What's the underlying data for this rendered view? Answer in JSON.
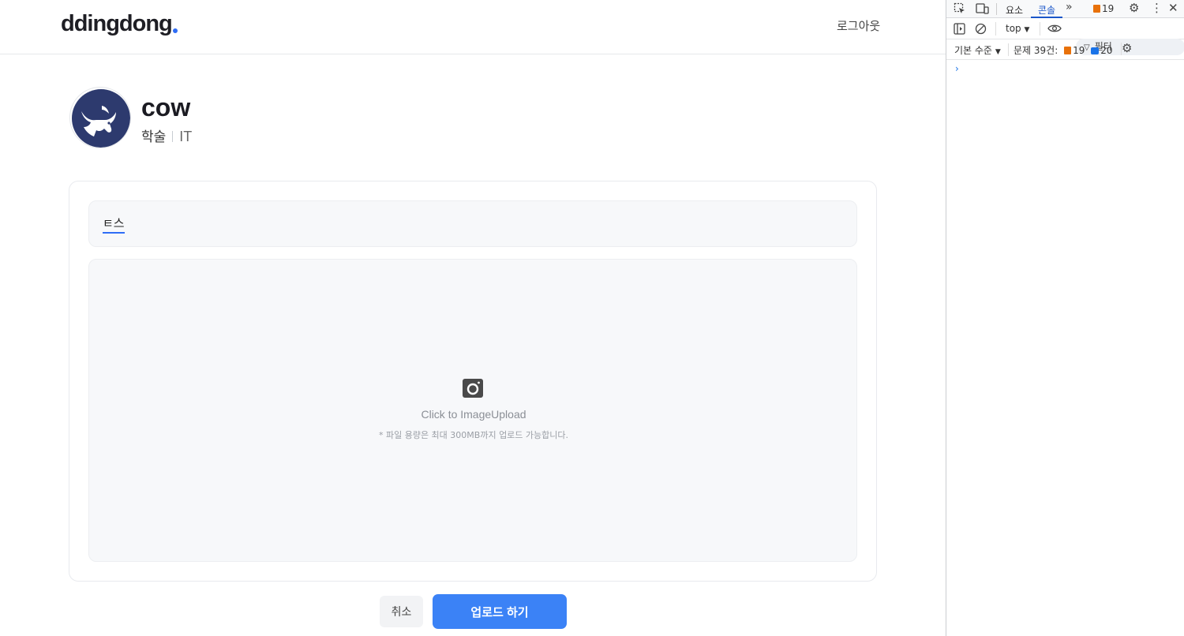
{
  "header": {
    "logo": "ddingdong",
    "logout_label": "로그아웃"
  },
  "club": {
    "name": "cow",
    "category": "학술",
    "field": "IT"
  },
  "form": {
    "title_value": "ㅌ스",
    "upload_label": "Click to ImageUpload",
    "upload_note": "* 파일 용량은 최대 300MB까지 업로드 가능합니다.",
    "cancel_label": "취소",
    "submit_label": "업로드 하기"
  },
  "corner_text": "?",
  "devtools": {
    "tabs": [
      "요소",
      "콘솔"
    ],
    "active_tab": "콘솔",
    "issue_count_top": "19",
    "context": "top",
    "filter_placeholder": "필터",
    "level_label": "기본 수준",
    "issues_label": "문제 39건:",
    "issues_warn": "19",
    "issues_info": "20",
    "prompt": "›"
  },
  "colors": {
    "accent": "#3b82f6",
    "logo_dot": "#2f6df6",
    "avatar_bg": "#2d3a6e"
  }
}
